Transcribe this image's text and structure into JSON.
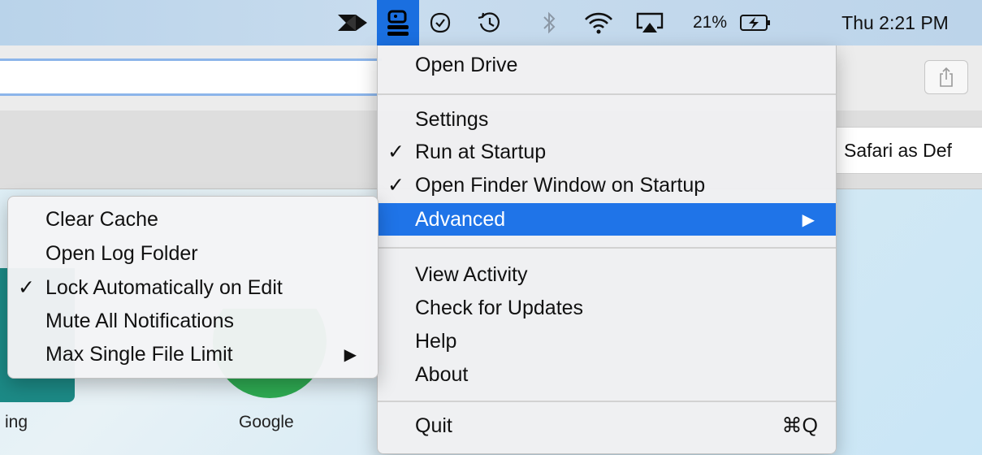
{
  "menubar": {
    "icons": [
      "paper-plane-icon",
      "drive-app-icon",
      "checkmark-badge-icon",
      "time-machine-icon",
      "bluetooth-icon",
      "wifi-icon",
      "airplay-icon",
      "battery-charging-icon"
    ],
    "battery_percent": "21%",
    "clock": "Thu 2:21 PM"
  },
  "browser": {
    "default_browser_banner": "Safari as Def",
    "favorites": [
      {
        "label": "ing"
      },
      {
        "label": "Google"
      }
    ]
  },
  "main_menu": {
    "items": [
      {
        "label": "Open Drive",
        "checked": false
      },
      {
        "label": "Settings",
        "checked": false
      },
      {
        "label": "Run at Startup",
        "checked": true
      },
      {
        "label": "Open Finder Window on Startup",
        "checked": true
      },
      {
        "label": "Advanced",
        "checked": false,
        "has_submenu": true,
        "highlighted": true
      },
      {
        "label": "View Activity",
        "checked": false
      },
      {
        "label": "Check for Updates",
        "checked": false
      },
      {
        "label": "Help",
        "checked": false
      },
      {
        "label": "About",
        "checked": false
      },
      {
        "label": "Quit",
        "checked": false,
        "shortcut": "⌘Q"
      }
    ]
  },
  "advanced_submenu": {
    "items": [
      {
        "label": "Clear Cache",
        "checked": false
      },
      {
        "label": "Open Log Folder",
        "checked": false
      },
      {
        "label": "Lock Automatically on Edit",
        "checked": true
      },
      {
        "label": "Mute All Notifications",
        "checked": false
      },
      {
        "label": "Max Single File Limit",
        "checked": false,
        "has_submenu": true
      }
    ]
  },
  "symbols": {
    "check": "✓",
    "submenu_arrow": "▶"
  },
  "colors": {
    "highlight": "#1f74e8",
    "active_menubar_item": "#1a6fe0"
  }
}
